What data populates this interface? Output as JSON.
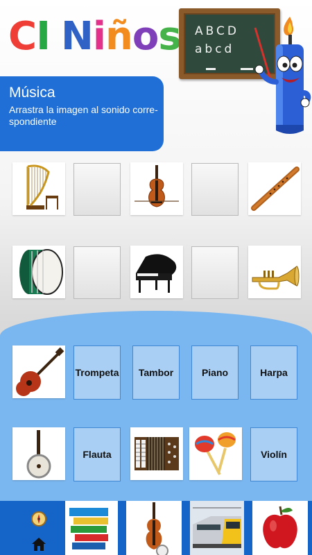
{
  "app": {
    "title_letters": [
      {
        "ch": "C",
        "color": "#ef3e36"
      },
      {
        "ch": "I",
        "color": "#27a844"
      },
      {
        "ch": " ",
        "color": "#000000"
      },
      {
        "ch": "N",
        "color": "#2f62c4"
      },
      {
        "ch": "i",
        "color": "#e2308b"
      },
      {
        "ch": "ñ",
        "color": "#f28c1f"
      },
      {
        "ch": "o",
        "color": "#7e3fb8"
      },
      {
        "ch": "s",
        "color": "#46b34a"
      }
    ]
  },
  "chalkboard": {
    "line1": "ABCD",
    "line2": "abcd"
  },
  "lesson": {
    "title": "Música",
    "instructions": "Arrastra la imagen al sonido corre-spondiente"
  },
  "images": {
    "harp": "harp-image",
    "violin": "violin-image",
    "flute": "flute-image",
    "drum": "bass-drum-image",
    "piano": "grand-piano-image",
    "trumpet": "trumpet-image",
    "guitar": "guitar-image",
    "banjo": "banjo-image",
    "accordion": "accordion-image",
    "maracas": "maracas-image"
  },
  "sound_options": [
    "Trompeta",
    "Tambor",
    "Piano",
    "Harpa",
    "Flauta",
    "Violín"
  ],
  "nav": {
    "icons": [
      "compass-icon",
      "home-icon"
    ],
    "categories": [
      "books-image",
      "violin-image",
      "train-image",
      "apple-image"
    ]
  },
  "colors": {
    "panel_blue": "#1f6fd6",
    "drop_area_blue": "#7ab7f0",
    "option_fill": "#a9cff5",
    "bottom_bar": "#1565c8"
  }
}
